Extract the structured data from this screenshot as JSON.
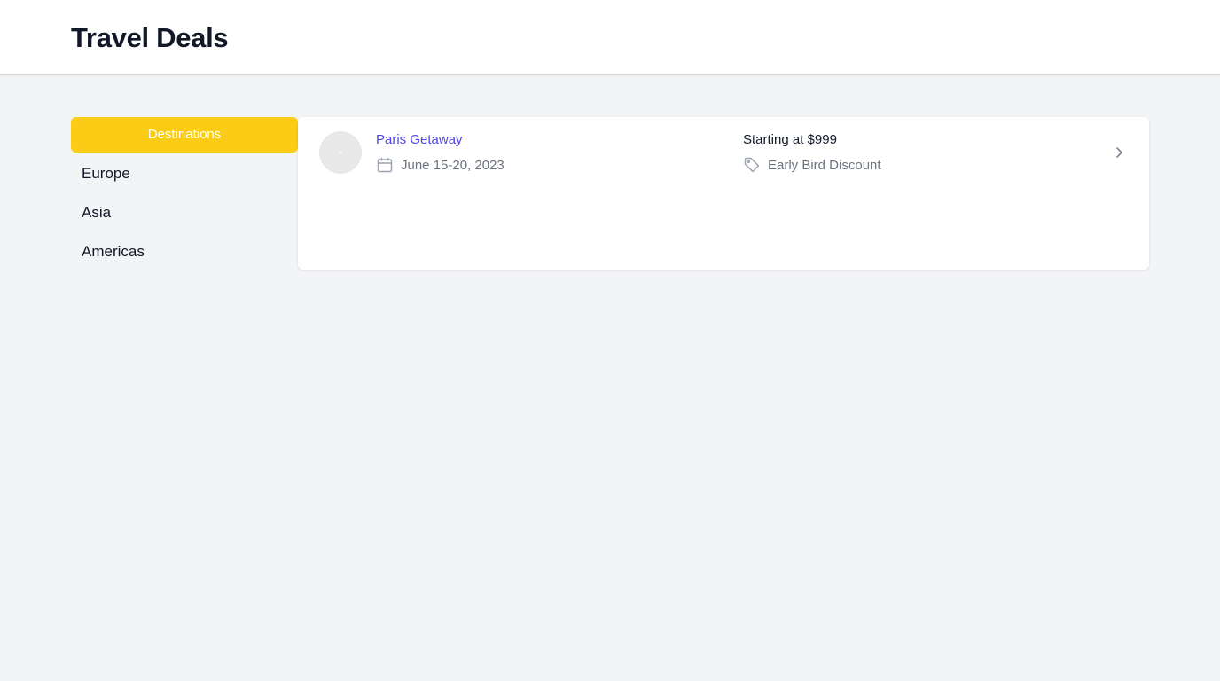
{
  "header": {
    "title": "Travel Deals"
  },
  "sidebar": {
    "header_label": "Destinations",
    "items": [
      {
        "label": "Europe"
      },
      {
        "label": "Asia"
      },
      {
        "label": "Americas"
      }
    ]
  },
  "deals": [
    {
      "name": "Paris Getaway",
      "dates": "June 15-20, 2023",
      "price_prefix": "Starting at",
      "price": "$999",
      "discount": "Early Bird Discount",
      "date_icon": "calendar-icon",
      "discount_icon": "tag-icon",
      "action_icon": "chevron-right-icon"
    }
  ],
  "colors": {
    "accent": "#facc15",
    "link": "#4f46e5",
    "muted_text": "#6b7280",
    "background": "#f3f4f6"
  }
}
